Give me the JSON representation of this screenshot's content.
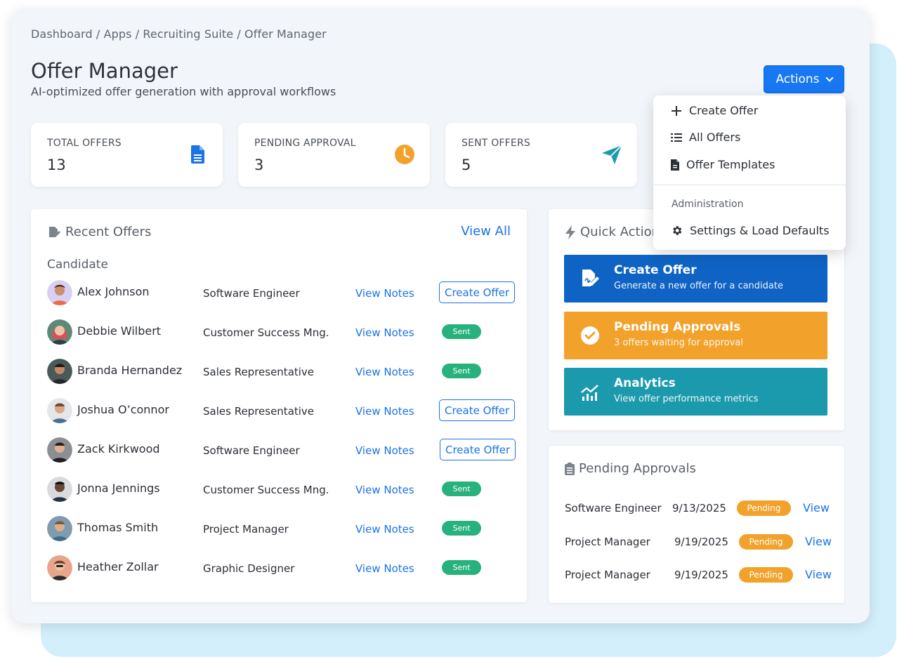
{
  "breadcrumb": {
    "path": "Dashboard / Apps / Recruiting Suite / Offer Manager"
  },
  "header": {
    "title": "Offer Manager",
    "subtitle": "AI-optimized offer generation with approval workflows",
    "actions_label": "Actions"
  },
  "stats": [
    {
      "label": "TOTAL OFFERS",
      "value": "13",
      "icon": "document-icon",
      "color": "#1a73e8"
    },
    {
      "label": "PENDING APPROVAL",
      "value": "3",
      "icon": "clock-icon",
      "color": "#f2a22b"
    },
    {
      "label": "SENT OFFERS",
      "value": "5",
      "icon": "paper-plane-icon",
      "color": "#1c9aad"
    }
  ],
  "recent_offers": {
    "title": "Recent Offers",
    "view_all": "View All",
    "column": "Candidate",
    "rows": [
      {
        "name": "Alex Johnson",
        "role": "Software Engineer",
        "notes": "View Notes",
        "status": "Create Offer",
        "type": "button"
      },
      {
        "name": "Debbie Wilbert",
        "role": "Customer Success Mng.",
        "notes": "View Notes",
        "status": "Sent",
        "type": "badge"
      },
      {
        "name": "Branda Hernandez",
        "role": "Sales Representative",
        "notes": "View Notes",
        "status": "Sent",
        "type": "badge"
      },
      {
        "name": "Joshua O’connor",
        "role": "Sales Representative",
        "notes": "View Notes",
        "status": "Create Offer",
        "type": "button"
      },
      {
        "name": "Zack Kirkwood",
        "role": "Software Engineer",
        "notes": "View Notes",
        "status": "Create Offer",
        "type": "button"
      },
      {
        "name": "Jonna Jennings",
        "role": "Customer Success Mng.",
        "notes": "View Notes",
        "status": "Sent",
        "type": "badge"
      },
      {
        "name": "Thomas Smith",
        "role": "Project Manager",
        "notes": "View Notes",
        "status": "Sent",
        "type": "badge"
      },
      {
        "name": "Heather Zollar",
        "role": "Graphic Designer",
        "notes": "View Notes",
        "status": "Sent",
        "type": "badge"
      }
    ]
  },
  "quick_actions": {
    "title": "Quick Actions",
    "items": [
      {
        "title": "Create Offer",
        "subtitle": "Generate a new offer for a candidate",
        "color": "#0f63c4",
        "icon": "file-signature-icon"
      },
      {
        "title": "Pending Approvals",
        "subtitle": "3 offers waiting for approval",
        "color": "#f2a22b",
        "icon": "check-circle-icon"
      },
      {
        "title": "Analytics",
        "subtitle": "View offer performance metrics",
        "color": "#1c9aad",
        "icon": "chart-line-icon"
      }
    ]
  },
  "pending_approvals": {
    "title": "Pending Approvals",
    "rows": [
      {
        "role": "Software Engineer",
        "date": "9/13/2025",
        "status": "Pending",
        "action": "View"
      },
      {
        "role": "Project Manager",
        "date": "9/19/2025",
        "status": "Pending",
        "action": "View"
      },
      {
        "role": "Project Manager",
        "date": "9/19/2025",
        "status": "Pending",
        "action": "View"
      }
    ]
  },
  "actions_menu": {
    "items": [
      {
        "label": "Create Offer",
        "icon": "plus-icon"
      },
      {
        "label": "All Offers",
        "icon": "list-icon"
      },
      {
        "label": "Offer Templates",
        "icon": "file-icon"
      }
    ],
    "group_label": "Administration",
    "admin_items": [
      {
        "label": "Settings & Load Defaults",
        "icon": "gear-icon"
      }
    ]
  }
}
